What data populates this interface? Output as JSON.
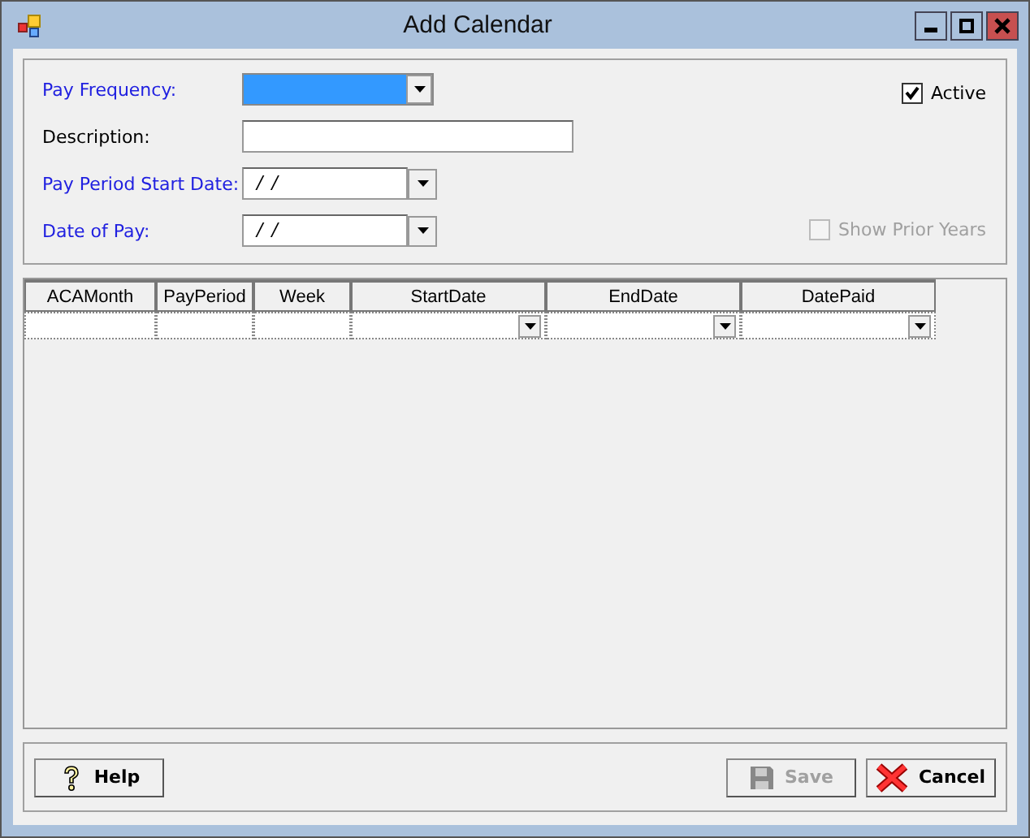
{
  "window": {
    "title": "Add Calendar"
  },
  "fields": [
    {
      "kind": "combo",
      "label": "Pay Frequency:",
      "required": true,
      "focused": true
    },
    {
      "kind": "text",
      "label": "Description:",
      "required": false,
      "focused": false
    },
    {
      "kind": "date",
      "label": "Pay Period Start Date:",
      "required": true,
      "focused": false,
      "value": "/ /"
    },
    {
      "kind": "date",
      "label": "Date of Pay:",
      "required": true,
      "focused": false,
      "value": "/ /"
    }
  ],
  "checkboxes": [
    {
      "label": "Active",
      "checked": true,
      "disabled": false
    },
    {
      "label": "Show Prior Years",
      "checked": false,
      "disabled": true
    }
  ],
  "table": {
    "columns": [
      {
        "label": "ACAMonth",
        "kind": "text"
      },
      {
        "label": "PayPeriod",
        "kind": "text"
      },
      {
        "label": "Week",
        "kind": "text"
      },
      {
        "label": "StartDate",
        "kind": "combo"
      },
      {
        "label": "EndDate",
        "kind": "combo"
      },
      {
        "label": "DatePaid",
        "kind": "combo"
      }
    ]
  },
  "buttons": [
    {
      "kind": "help",
      "label": "Help",
      "disabled": false
    },
    {
      "kind": "save",
      "label": "Save",
      "disabled": true
    },
    {
      "kind": "cancel",
      "label": "Cancel",
      "disabled": false
    }
  ]
}
